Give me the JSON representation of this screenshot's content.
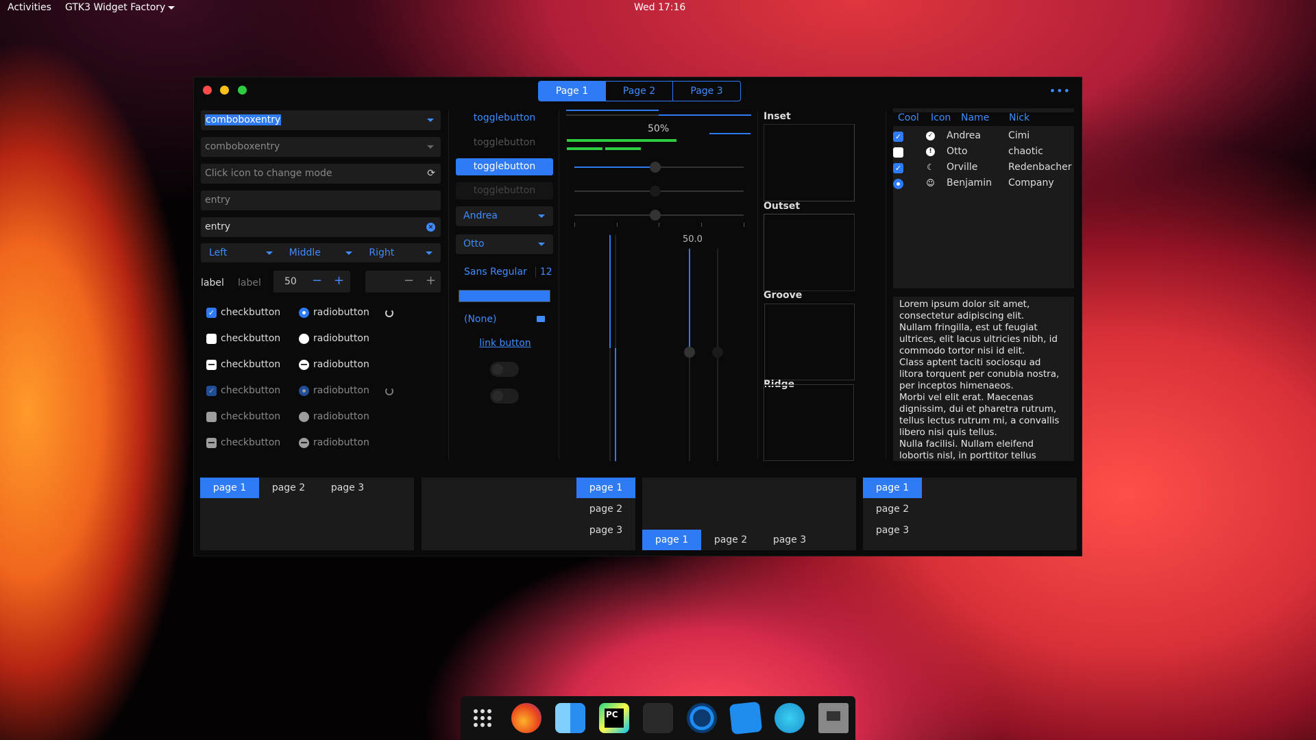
{
  "topbar": {
    "activities": "Activities",
    "app_menu": "GTK3 Widget Factory",
    "clock": "Wed 17:16"
  },
  "header_tabs": [
    "Page 1",
    "Page 2",
    "Page 3"
  ],
  "col1": {
    "combo1": "comboboxentry",
    "combo2": "comboboxentry",
    "mode_entry_placeholder": "Click icon to change mode",
    "entry1_placeholder": "entry",
    "entry2_value": "entry",
    "lmr": [
      "Left",
      "Middle",
      "Right"
    ],
    "label1": "label",
    "label2": "label",
    "spin_value": "50",
    "checks": [
      {
        "label": "checkbutton",
        "radio": "radiobutton"
      },
      {
        "label": "checkbutton",
        "radio": "radiobutton"
      },
      {
        "label": "checkbutton",
        "radio": "radiobutton"
      },
      {
        "label": "checkbutton",
        "radio": "radiobutton"
      },
      {
        "label": "checkbutton",
        "radio": "radiobutton"
      },
      {
        "label": "checkbutton",
        "radio": "radiobutton"
      }
    ]
  },
  "col2": {
    "toggles": [
      "togglebutton",
      "togglebutton",
      "togglebutton",
      "togglebutton"
    ],
    "combo_andrea": "Andrea",
    "combo_otto": "Otto",
    "font_name": "Sans Regular",
    "font_size": "12",
    "file_none": "(None)",
    "link": "link button"
  },
  "col3": {
    "progress_text": "50%",
    "scale_value": "50.0",
    "progress": 0.5
  },
  "frames": [
    "Inset",
    "Outset",
    "Groove",
    "Ridge"
  ],
  "tree": {
    "headers": [
      "Cool",
      "Icon",
      "Name",
      "Nick"
    ],
    "rows": [
      {
        "name": "Andrea",
        "nick": "Cimi"
      },
      {
        "name": "Otto",
        "nick": "chaotic"
      },
      {
        "name": "Orville",
        "nick": "Redenbacher"
      },
      {
        "name": "Benjamin",
        "nick": "Company"
      }
    ]
  },
  "textview": "Lorem ipsum dolor sit amet,\nconsectetur adipiscing elit.\nNullam fringilla, est ut feugiat\nultrices, elit lacus ultricies nibh, id\ncommodo tortor nisi id elit.\nClass aptent taciti sociosqu ad\nlitora torquent per conubia nostra,\nper inceptos himenaeos.\nMorbi vel elit erat. Maecenas\ndignissim, dui et pharetra rutrum,\ntellus lectus rutrum mi, a convallis\nlibero nisi quis tellus.\nNulla facilisi. Nullam eleifend\nlobortis nisl, in porttitor tellus",
  "notebooks": {
    "tabs": [
      "page 1",
      "page 2",
      "page 3"
    ]
  },
  "colors": {
    "accent": "#2f7bf5",
    "window_bg": "#0a0a0a",
    "field_bg": "#1d1d1d"
  },
  "dock": [
    "app-grid-icon",
    "firefox-icon",
    "finder-icon",
    "pycharm-icon",
    "terminal-icon",
    "power-icon",
    "screenshot-icon",
    "audio-icon",
    "terminal-app-icon"
  ]
}
